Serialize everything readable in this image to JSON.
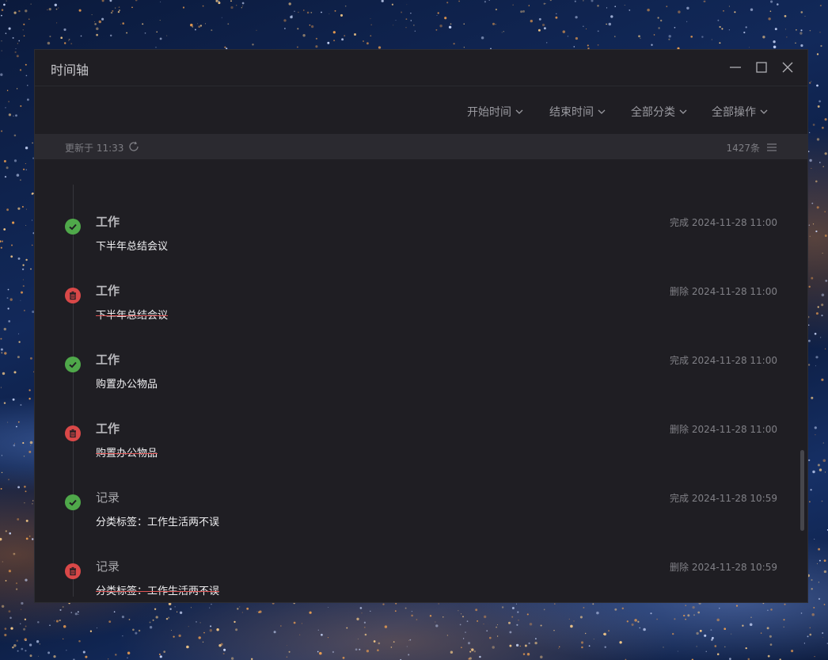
{
  "window": {
    "title": "时间轴"
  },
  "filters": [
    {
      "label": "开始时间"
    },
    {
      "label": "结束时间"
    },
    {
      "label": "全部分类"
    },
    {
      "label": "全部操作"
    }
  ],
  "status": {
    "updated": "更新于 11:33",
    "count": "1427条"
  },
  "entries": [
    {
      "status": "done",
      "category": "工作",
      "meta": "完成 2024-11-28 11:00",
      "content": "下半年总结会议"
    },
    {
      "status": "delete",
      "category": "工作",
      "meta": "删除 2024-11-28 11:00",
      "content": "下半年总结会议"
    },
    {
      "status": "done",
      "category": "工作",
      "meta": "完成 2024-11-28 11:00",
      "content": "购置办公物品"
    },
    {
      "status": "delete",
      "category": "工作",
      "meta": "删除 2024-11-28 11:00",
      "content": "购置办公物品"
    },
    {
      "status": "done",
      "category": "记录",
      "meta": "完成 2024-11-28 10:59",
      "content": "分类标签：工作生活两不误"
    },
    {
      "status": "delete",
      "category": "记录",
      "meta": "删除 2024-11-28 10:59",
      "content": "分类标签：工作生活两不误"
    }
  ],
  "colors": {
    "done": "#4fa84a",
    "delete": "#d94848",
    "window_bg": "#1f1e23",
    "status_bg": "#2b2a30"
  }
}
